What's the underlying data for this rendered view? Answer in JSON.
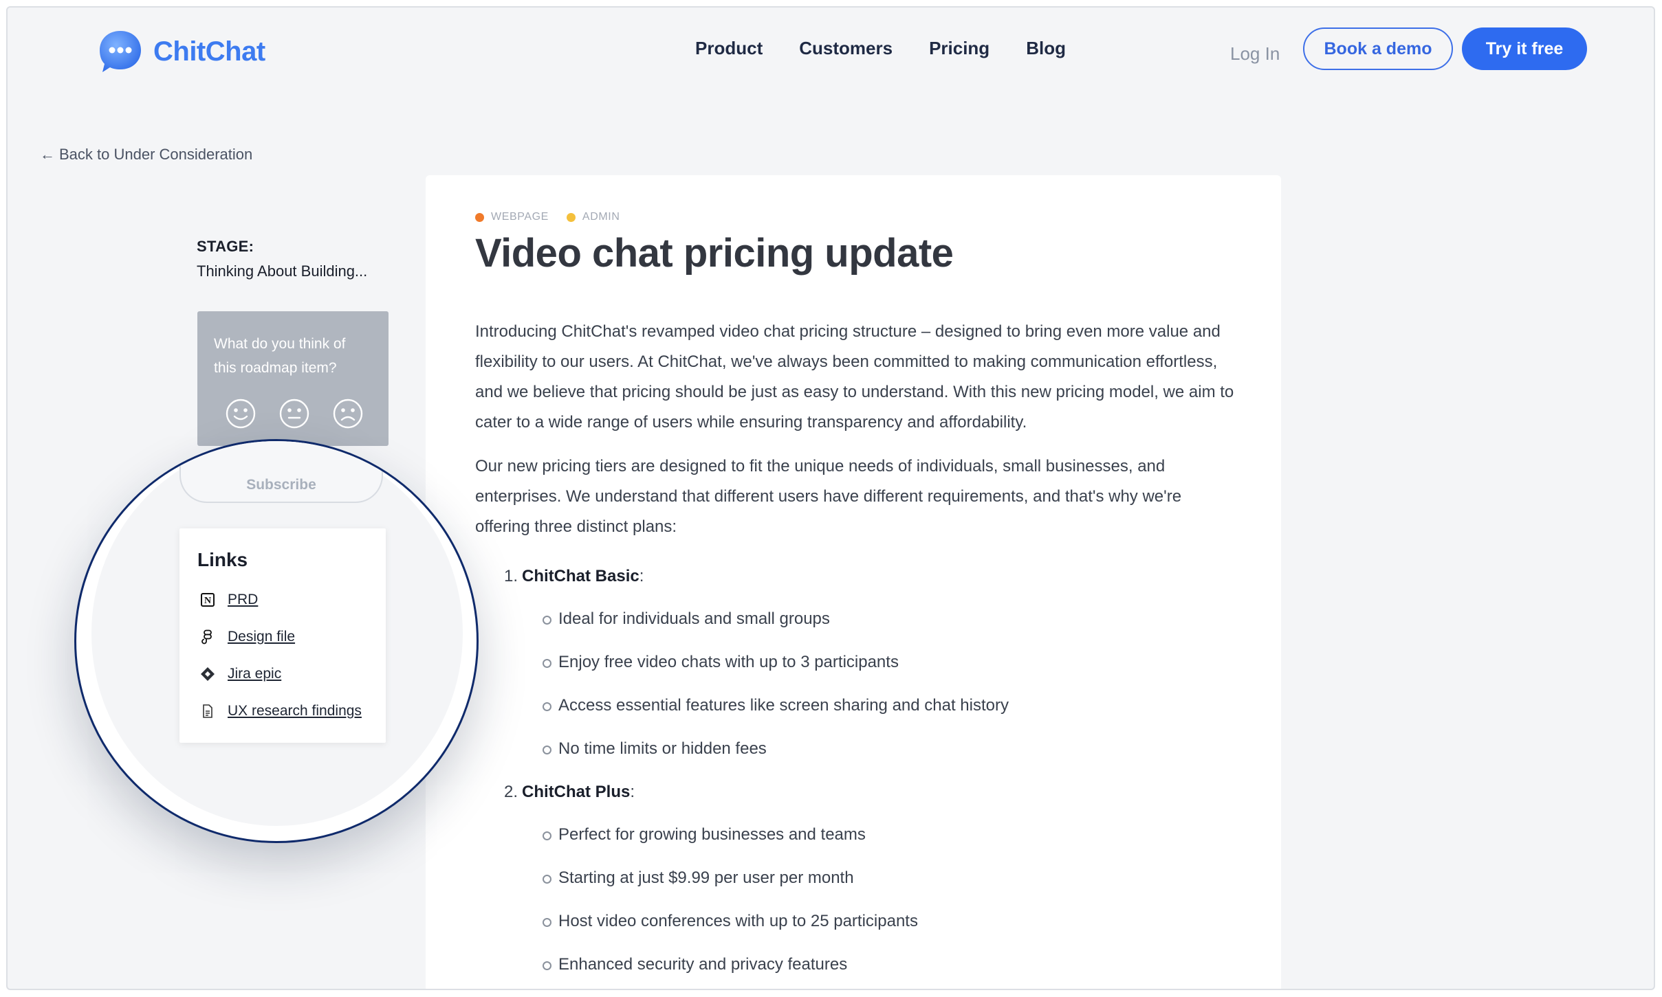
{
  "header": {
    "brand": "ChitChat",
    "nav": [
      "Product",
      "Customers",
      "Pricing",
      "Blog"
    ],
    "login": "Log In",
    "demo_button": "Book a demo",
    "try_button": "Try it free"
  },
  "back_link": "Back to Under Consideration",
  "sidebar": {
    "stage_label": "STAGE:",
    "stage_value": "Thinking About Building...",
    "feedback_question": "What do you think of this roadmap item?",
    "feedback_options": [
      "happy-face-icon",
      "neutral-face-icon",
      "sad-face-icon"
    ],
    "subscribe": "Subscribe",
    "links_title": "Links",
    "links": [
      {
        "label": "PRD",
        "icon": "notion-icon"
      },
      {
        "label": "Design file",
        "icon": "figma-icon"
      },
      {
        "label": "Jira epic",
        "icon": "jira-icon"
      },
      {
        "label": "UX research findings",
        "icon": "document-icon"
      }
    ]
  },
  "article": {
    "tags": [
      {
        "label": "WEBPAGE",
        "color": "#f07a2a"
      },
      {
        "label": "ADMIN",
        "color": "#f4c03c"
      }
    ],
    "title": "Video chat pricing update",
    "paragraphs": [
      "Introducing ChitChat's revamped video chat pricing structure – designed to bring even more value and flexibility to our users. At ChitChat, we've always been committed to making communication effortless, and we believe that pricing should be just as easy to understand. With this new pricing model, we aim to cater to a wide range of users while ensuring transparency and affordability.",
      "Our new pricing tiers are designed to fit the unique needs of individuals, small businesses, and enterprises. We understand that different users have different requirements, and that's why we're offering three distinct plans:"
    ],
    "plans": [
      {
        "number": "1.",
        "name": "ChitChat Basic",
        "bullets": [
          "Ideal for individuals and small groups",
          "Enjoy free video chats with up to 3 participants",
          "Access essential features like screen sharing and chat history",
          "No time limits or hidden fees"
        ]
      },
      {
        "number": "2.",
        "name": "ChitChat Plus",
        "bullets": [
          "Perfect for growing businesses and teams",
          "Starting at just $9.99 per user per month",
          "Host video conferences with up to 25 participants",
          "Enhanced security and privacy features"
        ]
      }
    ]
  },
  "colors": {
    "brand": "#3d7bf0",
    "primary_button": "#2e6bf0",
    "magnifier_border": "#0f2a6b"
  }
}
